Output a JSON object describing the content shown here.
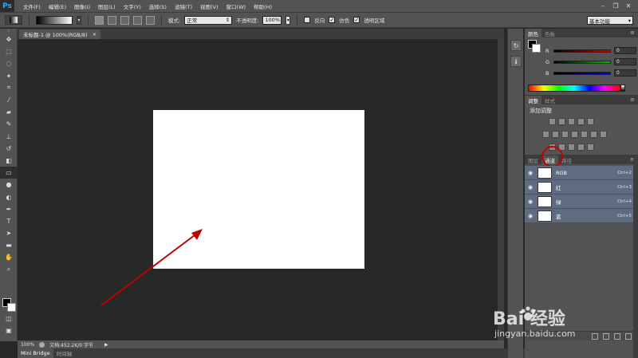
{
  "app": {
    "logo": "Ps"
  },
  "menu": [
    "文件(F)",
    "编辑(E)",
    "图像(I)",
    "图层(L)",
    "文字(Y)",
    "选择(S)",
    "滤镜(T)",
    "视图(V)",
    "窗口(W)",
    "帮助(H)"
  ],
  "window_controls": {
    "minimize": "–",
    "restore": "❐",
    "close": "✕"
  },
  "options": {
    "mode_label": "模式:",
    "mode_value": "正常",
    "opacity_label": "不透明度:",
    "opacity_value": "100%",
    "reverse_label": "反向",
    "dither_label": "仿色",
    "transparency_label": "透明区域",
    "workspace": "基本功能"
  },
  "document": {
    "tab_title": "未标题-1 @ 100%(RGB/8)",
    "tab_close": "×"
  },
  "status": {
    "zoom": "100%",
    "doc_info": "文档:452.2K/0 字节",
    "arrow": "▶"
  },
  "bottom_tabs": [
    "Mini Bridge",
    "时间轴"
  ],
  "color_panel": {
    "tabs": [
      "颜色",
      "色板"
    ],
    "sliders": [
      {
        "label": "R",
        "value": "0",
        "color": "#e00000"
      },
      {
        "label": "G",
        "value": "0",
        "color": "#00c000"
      },
      {
        "label": "B",
        "value": "0",
        "color": "#0000e0"
      }
    ]
  },
  "adjust_panel": {
    "tabs": [
      "调整",
      "样式"
    ],
    "title": "添加调整"
  },
  "channels_panel": {
    "tabs": [
      "图层",
      "通道",
      "路径"
    ],
    "channels": [
      {
        "name": "RGB",
        "shortcut": "Ctrl+2"
      },
      {
        "name": "红",
        "shortcut": "Ctrl+3"
      },
      {
        "name": "绿",
        "shortcut": "Ctrl+4"
      },
      {
        "name": "蓝",
        "shortcut": "Ctrl+5"
      }
    ]
  },
  "watermark": {
    "brand": "Bai 经验",
    "url": "jingyan.baidu.com"
  },
  "colors": {
    "annotation_red": "#c00000",
    "panel_bg": "#535353",
    "canvas_bg": "#282828",
    "channel_selected": "#5f6c80"
  }
}
